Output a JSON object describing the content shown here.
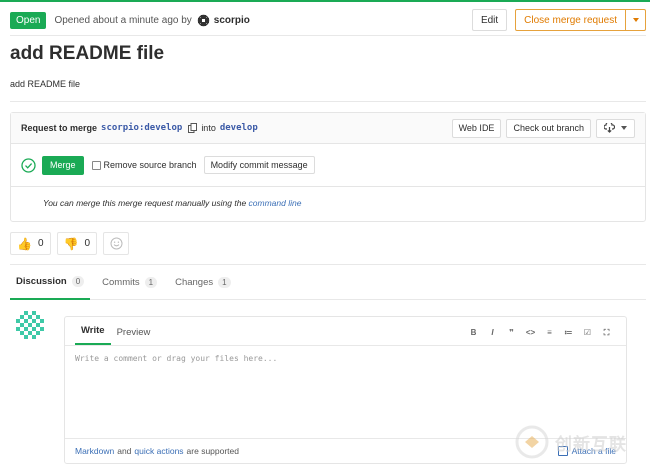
{
  "header": {
    "status": "Open",
    "opened_text": "Opened about a minute ago by",
    "author": "scorpio",
    "edit_label": "Edit",
    "close_label": "Close merge request"
  },
  "mr": {
    "title": "add README file",
    "description": "add README file"
  },
  "widget": {
    "request_prefix": "Request to merge",
    "source_branch": "scorpio:develop",
    "into_text": "into",
    "target_branch": "develop",
    "web_ide_label": "Web IDE",
    "checkout_label": "Check out branch",
    "merge_label": "Merge",
    "remove_source_label": "Remove source branch",
    "modify_commit_label": "Modify commit message",
    "manual_text": "You can merge this merge request manually using the",
    "command_line_link": "command line"
  },
  "awards": {
    "thumbs_up_count": "0",
    "thumbs_down_count": "0"
  },
  "tabs": [
    {
      "label": "Discussion",
      "count": "0"
    },
    {
      "label": "Commits",
      "count": "1"
    },
    {
      "label": "Changes",
      "count": "1"
    }
  ],
  "editor": {
    "write_tab": "Write",
    "preview_tab": "Preview",
    "placeholder": "Write a comment or drag your files here...",
    "tools": [
      "B",
      "I",
      "❞",
      "<>",
      "≡",
      "≔",
      "☑",
      "⛶"
    ],
    "markdown_link": "Markdown",
    "and_text": "and",
    "quick_actions_link": "quick actions",
    "supported_text": "are supported",
    "attach_label": "Attach a file"
  },
  "watermark": {
    "text": "创新互联"
  },
  "colors": {
    "accent": "#1aaa55",
    "warn": "#e07b00",
    "link": "#3b6fb6"
  }
}
